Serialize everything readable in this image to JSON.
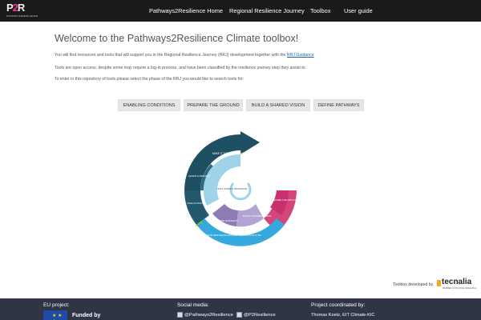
{
  "brand": {
    "logo_mark_p": "P",
    "logo_mark_2": "2",
    "logo_mark_r": "R",
    "logo_subtitle": "PATHWAYS2RESILIENCE"
  },
  "nav": {
    "items": [
      {
        "label": "Pathways2Resilience Home"
      },
      {
        "label": "Regional Resilience Journey"
      },
      {
        "label": "Toolbox"
      },
      {
        "label": "User guide"
      }
    ]
  },
  "main": {
    "title": "Welcome to the Pathways2Resilience Climate toolbox!",
    "intro_text": "You will find resources and tools that will support you in the Regional Resilience Journey (RRJ) development together with the",
    "intro_link": "RRJ Guidance",
    "access_text": "Tools are open access, despite some may require a log-in process, and have been classified by the resilience journey step they assist to.",
    "enter_text": "To enter in this repository of tools please select the phase of the RRJ you would like to search tools for:"
  },
  "phases": [
    {
      "label": "ENABLING CONDITIONS"
    },
    {
      "label": "PREPARE THE GROUND"
    },
    {
      "label": "BUILD A SHARED VISION"
    },
    {
      "label": "DEFINE PATHWAYS"
    }
  ],
  "wheel": {
    "colors": {
      "dark_teal": "#1f4f63",
      "teal": "#2a6b80",
      "light_blue": "#9ed3ea",
      "sky": "#35a8dd",
      "purple": "#8e7ab5",
      "lilac": "#b3a3d3",
      "pink": "#d6457a",
      "magenta": "#c8316e",
      "green": "#7ebd3b"
    },
    "segment_labels": {
      "make_it_new_normal": "MAKE IT THE NEW NORMAL",
      "learn_reflect": "LEARN & REFLECT",
      "take_action": "TAKE ACTION",
      "define_pathways": "DEFINE PATHWAYS",
      "build_vision": "BUILD A SHARED VISION",
      "prepare_ground": "PREPARE THE GROUND",
      "center": "JUST CLIMATE TRANSITION",
      "outer_band": "CLIMATE RESILIENCE STRATEGY, ACTION PLAN & INV."
    }
  },
  "credits": {
    "developed_by": "Toolbox developed by",
    "partner_name": "tecnalia",
    "partner_tagline": "MEMBER OF BASQUE RESEARCH"
  },
  "footer": {
    "eu_heading": "EU project:",
    "funded_label": "Funded by",
    "eu_stars": "★ ★ ★",
    "social_heading": "Social media:",
    "social_links": [
      {
        "label": "@Pathways2Resilience"
      },
      {
        "label": "@P2Resilience"
      }
    ],
    "coord_heading": "Project coordinated by:",
    "coord_name": "Thomas Koetz, EIT Climate-KIC"
  }
}
